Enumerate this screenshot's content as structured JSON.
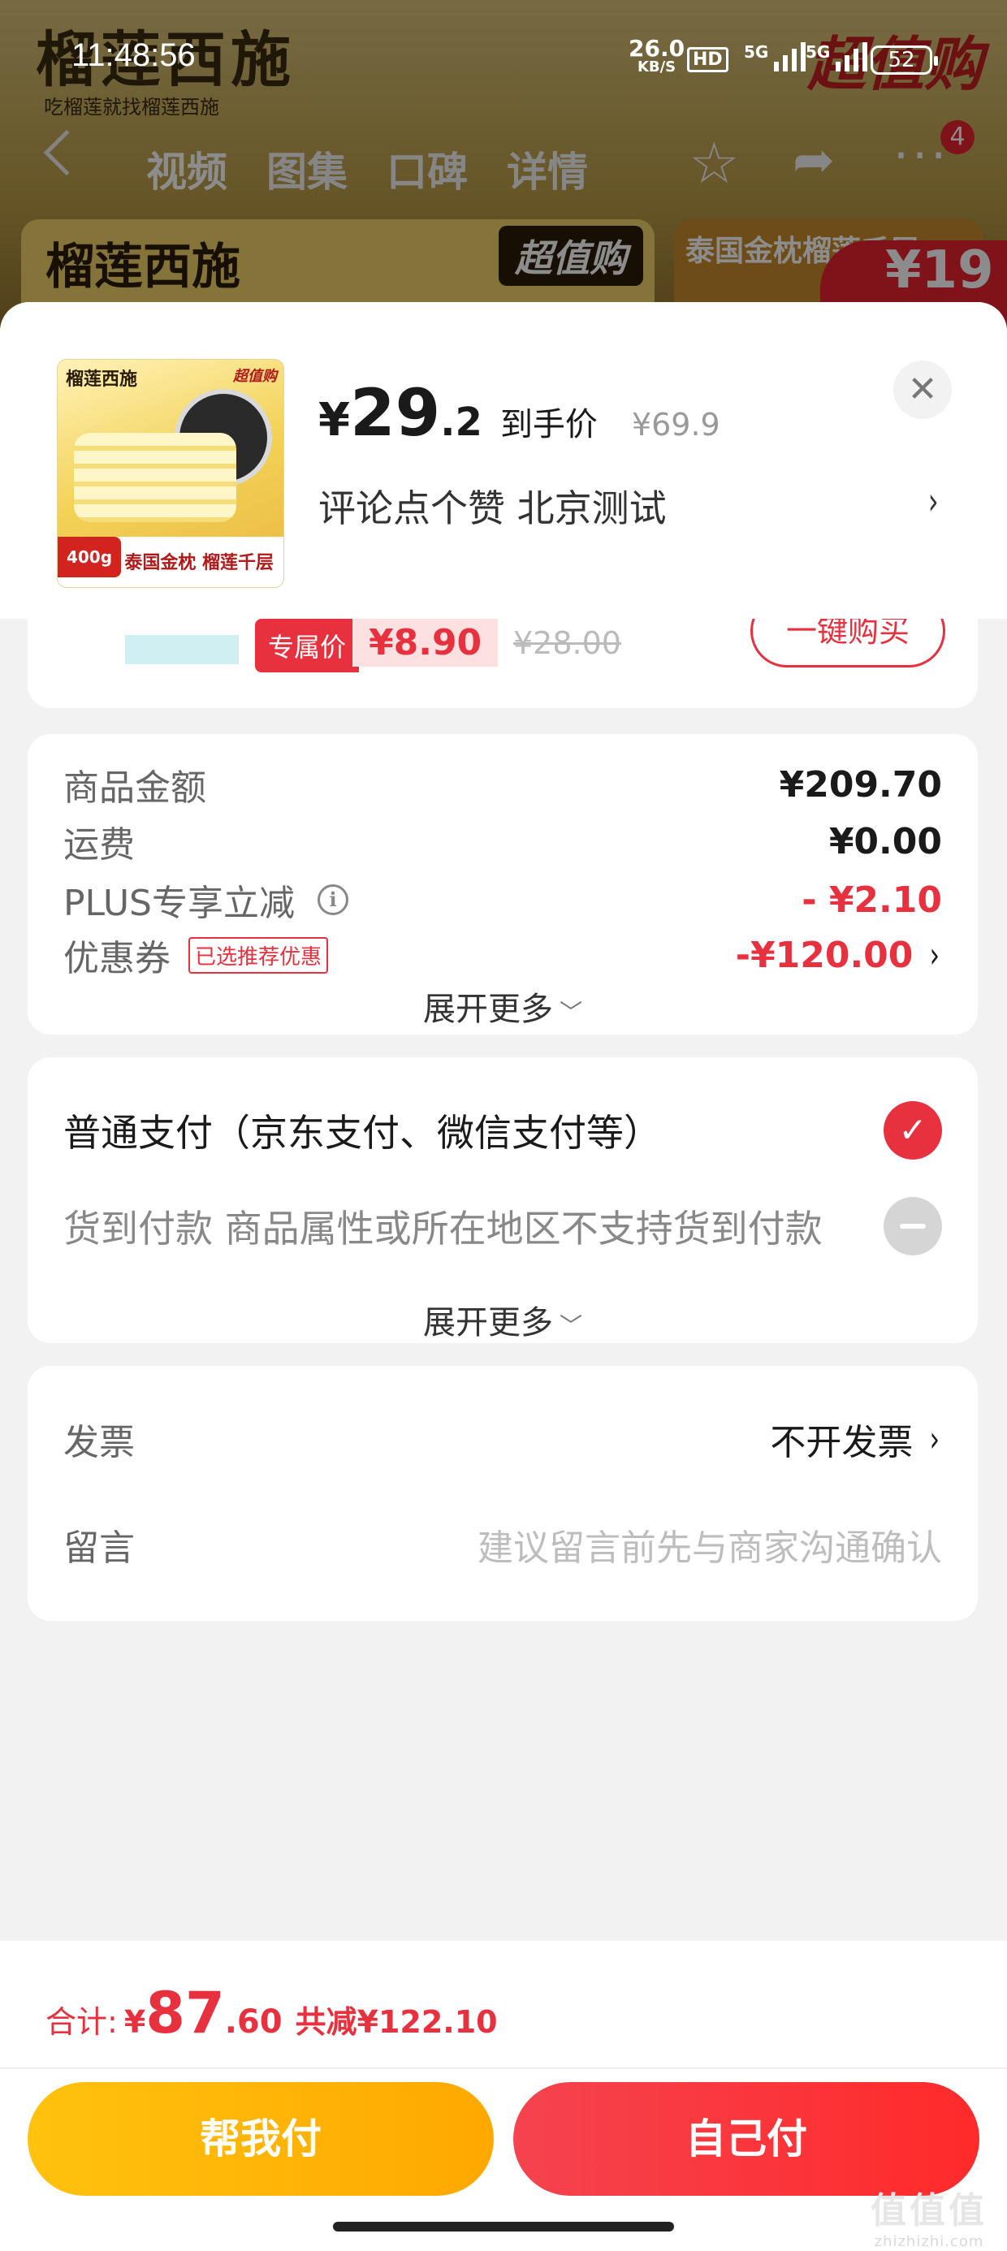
{
  "status_bar": {
    "time": "11:48:56",
    "speed": "26.0",
    "speed_unit": "KB/S",
    "hd": "HD",
    "sig1": "5G",
    "sig2": "5G",
    "battery": "52"
  },
  "background": {
    "brand_logo": "榴莲西施",
    "brand_slogan": "吃榴莲就找榴莲西施",
    "promo_tag": "超值购",
    "tabs": [
      "视频",
      "图集",
      "口碑",
      "详情"
    ],
    "notif_count": "4",
    "banner_right": "泰国金枕榴莲千层",
    "price_peek": "¥19"
  },
  "sheet": {
    "product": {
      "thumb_logo": "榴莲西施",
      "thumb_tag": "超值购",
      "thumb_weight": "400g",
      "thumb_caption": "泰国金枕 榴莲千层",
      "price_currency": "¥",
      "price_int": "29",
      "price_dec": ".2",
      "price_label": "到手价",
      "original_price": "¥69.9",
      "note": "评论点个赞  北京测试"
    },
    "peek_item": {
      "tag": "专属价",
      "price": "¥8.90",
      "old_price": "¥28.00",
      "buy_label": "一键购买"
    },
    "summary": {
      "goods_label": "商品金额",
      "goods_value": "¥209.70",
      "shipping_label": "运费",
      "shipping_value": "¥0.00",
      "plus_label": "PLUS专享立减",
      "plus_value": "- ¥2.10",
      "coupon_label": "优惠券",
      "coupon_badge": "已选推荐优惠",
      "coupon_value": "-¥120.00",
      "expand": "展开更多"
    },
    "payment": {
      "normal": "普通支付（京东支付、微信支付等）",
      "cod": "货到付款 商品属性或所在地区不支持货到付款",
      "expand": "展开更多"
    },
    "extras": {
      "invoice_label": "发票",
      "invoice_value": "不开发票",
      "message_label": "留言",
      "message_placeholder": "建议留言前先与商家沟通确认"
    }
  },
  "footer": {
    "total_label": "合计:",
    "total_currency": "¥",
    "total_int": "87",
    "total_dec": ".60",
    "saved": "共减¥122.10",
    "help_pay": "帮我付",
    "self_pay": "自己付",
    "watermark": "值值值",
    "watermark_url": "zhizhizhi.com"
  },
  "colors": {
    "accent_red": "#e8313e",
    "help_yellow": "#ffb400"
  }
}
